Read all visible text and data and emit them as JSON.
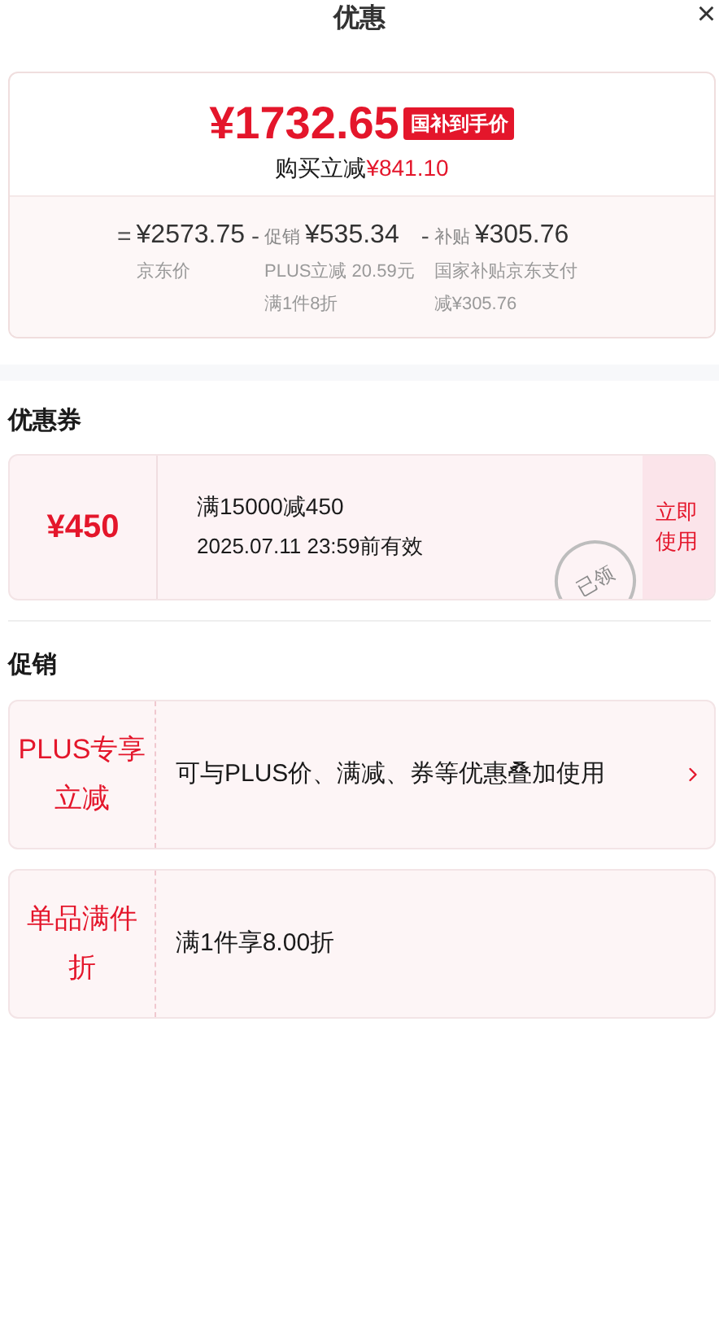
{
  "header": {
    "title": "优惠",
    "close": "×"
  },
  "price_card": {
    "price": "¥1732.65",
    "badge": "国补到手价",
    "saving_label": "购买立减",
    "saving_amount": "¥841.10",
    "breakdown": [
      {
        "operator": "=",
        "amount": "¥2573.75",
        "notes": [
          "京东价"
        ]
      },
      {
        "operator": "-",
        "label": "促销",
        "amount": "¥535.34",
        "notes": [
          "PLUS立减 20.59元",
          "满1件8折"
        ]
      },
      {
        "operator": "-",
        "label": "补贴",
        "amount": "¥305.76",
        "notes": [
          "国家补贴京东支付",
          "减¥305.76"
        ]
      }
    ]
  },
  "coupons": {
    "heading": "优惠券",
    "items": [
      {
        "amount": "¥450",
        "condition": "满15000减450",
        "validity": "2025.07.11 23:59前有效",
        "claimed": true,
        "stamp": "已领",
        "action": "立即使用"
      }
    ]
  },
  "promotions": {
    "heading": "促销",
    "items": [
      {
        "tag": "PLUS专享立减",
        "text": "可与PLUS价、满减、券等优惠叠加使用",
        "has_arrow": true
      },
      {
        "tag": "单品满件折",
        "text": "满1件享8.00折",
        "has_arrow": false
      }
    ]
  }
}
